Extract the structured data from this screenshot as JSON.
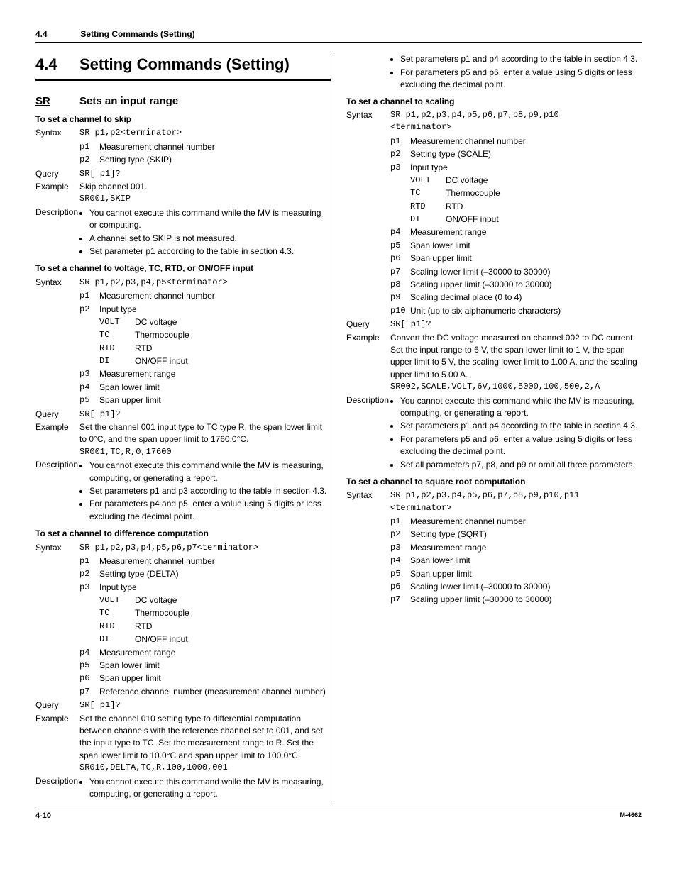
{
  "header": {
    "num": "4.4",
    "title": "Setting Commands (Setting)"
  },
  "section": {
    "num": "4.4",
    "title": "Setting Commands (Setting)"
  },
  "cmd": {
    "name": "SR",
    "desc": "Sets an input range"
  },
  "skip": {
    "head": "To set a channel to skip",
    "syntax_lbl": "Syntax",
    "syntax": "SR p1,p2<terminator>",
    "p1k": "p1",
    "p1": "Measurement channel number",
    "p2k": "p2",
    "p2": "Setting type (SKIP)",
    "query_lbl": "Query",
    "query": "SR[ p1]?",
    "ex_lbl": "Example",
    "ex_txt": "Skip channel 001.",
    "ex_code": "SR001,SKIP",
    "desc_lbl": "Description",
    "d1": "You cannot execute this command while the MV is measuring or computing.",
    "d2": "A channel set to SKIP is not measured.",
    "d3": "Set parameter p1 according to the table in section 4.3."
  },
  "volt": {
    "head": "To set a channel to voltage, TC, RTD, or ON/OFF input",
    "syntax_lbl": "Syntax",
    "syntax": "SR p1,p2,p3,p4,p5<terminator>",
    "p1k": "p1",
    "p1": "Measurement channel number",
    "p2k": "p2",
    "p2": "Input type",
    "it1k": "VOLT",
    "it1": "DC voltage",
    "it2k": "TC",
    "it2": "Thermocouple",
    "it3k": "RTD",
    "it3": "RTD",
    "it4k": "DI",
    "it4": "ON/OFF input",
    "p3k": "p3",
    "p3": "Measurement range",
    "p4k": "p4",
    "p4": "Span lower limit",
    "p5k": "p5",
    "p5": "Span upper limit",
    "query_lbl": "Query",
    "query": "SR[ p1]?",
    "ex_lbl": "Example",
    "ex_txt": "Set the channel 001 input type to TC type R, the span lower limit to 0°C, and the span upper limit to 1760.0°C.",
    "ex_code": "SR001,TC,R,0,17600",
    "desc_lbl": "Description",
    "d1": "You cannot execute this command while the MV is measuring, computing, or generating a report.",
    "d2": "Set parameters p1 and p3 according to the table in section 4.3.",
    "d3": "For parameters p4 and p5, enter a value using 5 digits or less excluding the decimal point."
  },
  "delta": {
    "head": "To set a channel to difference computation",
    "syntax_lbl": "Syntax",
    "syntax": "SR p1,p2,p3,p4,p5,p6,p7<terminator>",
    "p1k": "p1",
    "p1": "Measurement channel number",
    "p2k": "p2",
    "p2": "Setting type (DELTA)",
    "p3k": "p3",
    "p3": "Input type",
    "it1k": "VOLT",
    "it1": "DC voltage",
    "it2k": "TC",
    "it2": "Thermocouple",
    "it3k": "RTD",
    "it3": "RTD",
    "it4k": "DI",
    "it4": "ON/OFF input",
    "p4k": "p4",
    "p4": "Measurement range",
    "p5k": "p5",
    "p5": "Span lower limit",
    "p6k": "p6",
    "p6": "Span upper limit",
    "p7k": "p7",
    "p7": "Reference channel number (measurement channel number)",
    "query_lbl": "Query",
    "query": "SR[ p1]?",
    "ex_lbl": "Example",
    "ex_txt": "Set the channel 010 setting type to differential computation between channels with the reference channel set to 001, and set the input type to TC. Set the measurement range to R. Set the span lower limit to 10.0°C and span upper limit to 100.0°C.",
    "ex_code": "SR010,DELTA,TC,R,100,1000,001",
    "desc_lbl": "Description",
    "d1": "You cannot execute this command while the MV is measuring, computing, or generating a report.",
    "d2": "Set parameters p1 and p4 according to the table in section 4.3.",
    "d3": "For parameters p5 and p6, enter a value using 5 digits or less excluding the decimal point."
  },
  "scale": {
    "head": "To set a channel to scaling",
    "syntax_lbl": "Syntax",
    "syntax": "SR p1,p2,p3,p4,p5,p6,p7,p8,p9,p10",
    "syntax2": "<terminator>",
    "p1k": "p1",
    "p1": "Measurement channel number",
    "p2k": "p2",
    "p2": "Setting type (SCALE)",
    "p3k": "p3",
    "p3": "Input type",
    "it1k": "VOLT",
    "it1": "DC voltage",
    "it2k": "TC",
    "it2": "Thermocouple",
    "it3k": "RTD",
    "it3": "RTD",
    "it4k": "DI",
    "it4": "ON/OFF input",
    "p4k": "p4",
    "p4": "Measurement range",
    "p5k": "p5",
    "p5": "Span lower limit",
    "p6k": "p6",
    "p6": "Span upper limit",
    "p7k": "p7",
    "p7": "Scaling lower limit (–30000 to 30000)",
    "p8k": "p8",
    "p8": "Scaling upper limit (–30000 to 30000)",
    "p9k": "p9",
    "p9": "Scaling decimal place (0 to 4)",
    "p10k": "p10",
    "p10": "Unit (up to six alphanumeric characters)",
    "query_lbl": "Query",
    "query": "SR[ p1]?",
    "ex_lbl": "Example",
    "ex_txt": "Convert the DC voltage measured on channel 002 to DC current. Set the input range to 6 V, the span lower limit to 1 V, the span upper limit to 5 V, the scaling lower limit to 1.00 A, and the scaling upper limit to 5.00 A.",
    "ex_code": "SR002,SCALE,VOLT,6V,1000,5000,100,500,2,A",
    "desc_lbl": "Description",
    "d1": "You cannot execute this command while the MV is measuring, computing, or generating a report.",
    "d2": "Set parameters p1 and p4 according to the table in section 4.3.",
    "d3": "For parameters p5 and p6, enter a value using 5 digits or less excluding the decimal point.",
    "d4": "Set all parameters p7, p8, and p9 or omit all three parameters."
  },
  "sqrt": {
    "head": "To set a channel to square root computation",
    "syntax_lbl": "Syntax",
    "syntax": "SR p1,p2,p3,p4,p5,p6,p7,p8,p9,p10,p11",
    "syntax2": "<terminator>",
    "p1k": "p1",
    "p1": "Measurement channel number",
    "p2k": "p2",
    "p2": "Setting type (SQRT)",
    "p3k": "p3",
    "p3": "Measurement range",
    "p4k": "p4",
    "p4": "Span lower limit",
    "p5k": "p5",
    "p5": "Span upper limit",
    "p6k": "p6",
    "p6": "Scaling lower limit (–30000 to 30000)",
    "p7k": "p7",
    "p7": "Scaling upper limit (–30000 to 30000)"
  },
  "footer": {
    "page": "4-10",
    "doc": "M-4662"
  }
}
